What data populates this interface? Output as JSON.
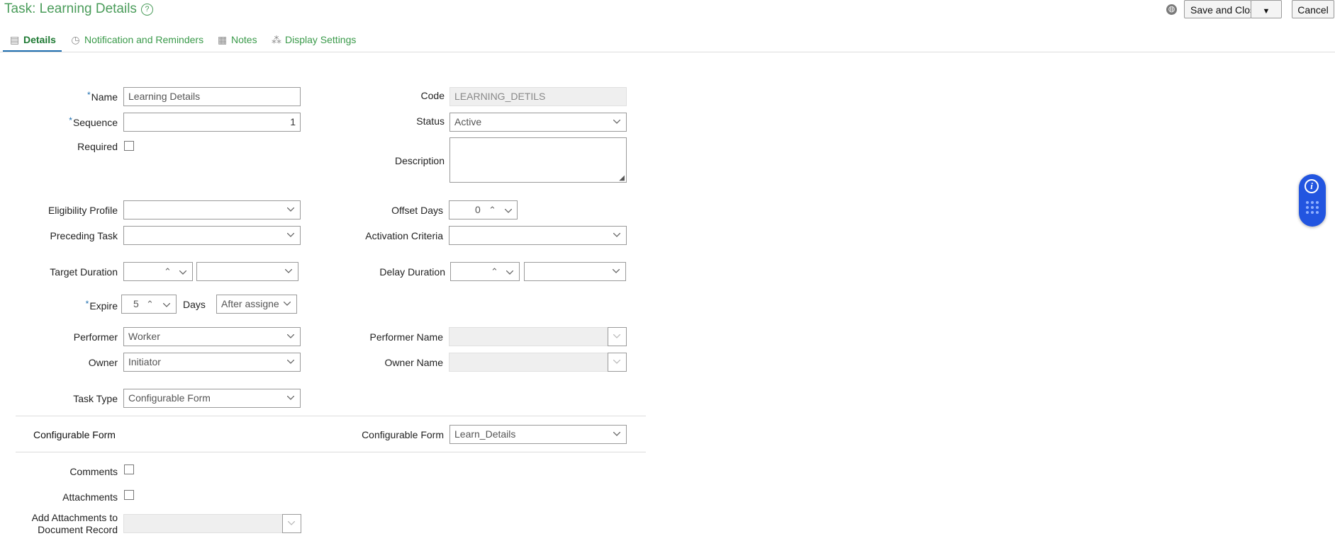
{
  "header": {
    "title": "Task: Learning Details",
    "save_label": "Save and Close",
    "cancel_label": "Cancel"
  },
  "tabs": [
    {
      "label": "Details",
      "icon": "clipboard-icon",
      "active": true
    },
    {
      "label": "Notification and Reminders",
      "icon": "timer-icon"
    },
    {
      "label": "Notes",
      "icon": "notes-icon"
    },
    {
      "label": "Display Settings",
      "icon": "settings-dots-icon"
    }
  ],
  "form": {
    "name": {
      "label": "Name",
      "value": "Learning Details"
    },
    "code": {
      "label": "Code",
      "value": "LEARNING_DETILS"
    },
    "sequence": {
      "label": "Sequence",
      "value": "1"
    },
    "status": {
      "label": "Status",
      "value": "Active"
    },
    "required": {
      "label": "Required"
    },
    "description": {
      "label": "Description",
      "value": ""
    },
    "eligibility_profile": {
      "label": "Eligibility Profile",
      "value": ""
    },
    "offset_days": {
      "label": "Offset Days",
      "value": "0"
    },
    "preceding_task": {
      "label": "Preceding Task",
      "value": ""
    },
    "activation_criteria": {
      "label": "Activation Criteria",
      "value": ""
    },
    "target_duration": {
      "label": "Target Duration",
      "value": ""
    },
    "delay_duration": {
      "label": "Delay Duration",
      "value": ""
    },
    "expire": {
      "label": "Expire",
      "value": "5",
      "unit_label": "Days",
      "select_value": "After assigne"
    },
    "performer": {
      "label": "Performer",
      "value": "Worker"
    },
    "performer_name": {
      "label": "Performer Name",
      "value": ""
    },
    "owner": {
      "label": "Owner",
      "value": "Initiator"
    },
    "owner_name": {
      "label": "Owner Name",
      "value": ""
    },
    "task_type": {
      "label": "Task Type",
      "value": "Configurable Form"
    }
  },
  "configurable_form_section": {
    "heading": "Configurable Form",
    "field_label": "Configurable Form",
    "value": "Learn_Details"
  },
  "extras": {
    "comments_label": "Comments",
    "attachments_label": "Attachments",
    "add_attachments_label": "Add Attachments to Document Record"
  },
  "colors": {
    "title_green": "#4a9c5a",
    "tab_underline": "#1f6fb0",
    "assistant_blue": "#2255e0"
  }
}
